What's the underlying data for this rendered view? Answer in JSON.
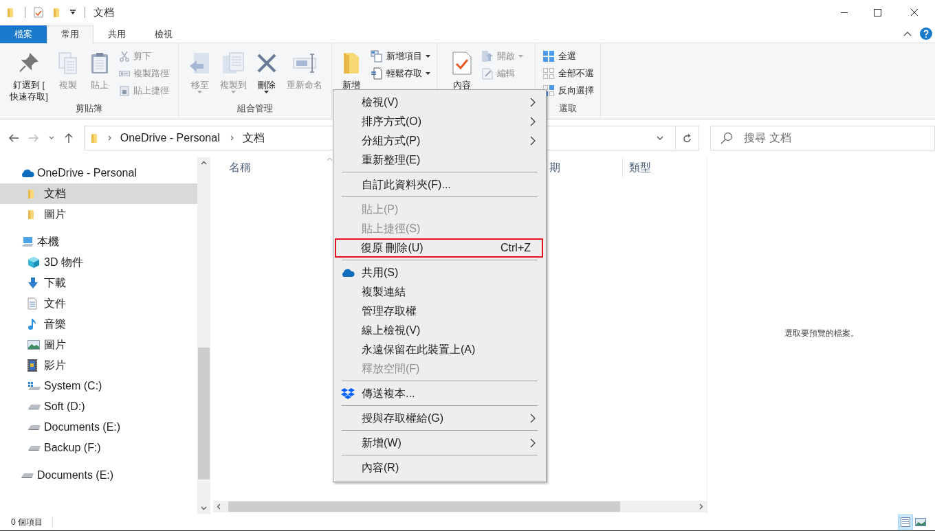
{
  "window": {
    "title": "文档"
  },
  "ribbon_tabs": [
    {
      "label": "檔案",
      "kind": "file",
      "selected": false
    },
    {
      "label": "常用",
      "kind": "tab",
      "selected": true
    },
    {
      "label": "共用",
      "kind": "tab",
      "selected": false
    },
    {
      "label": "檢視",
      "kind": "tab",
      "selected": false
    }
  ],
  "ribbon_groups": [
    {
      "label": "剪貼簿",
      "items": [
        {
          "kind": "large",
          "label": "釘選到 [\n快速存取]",
          "disabled": false,
          "dropdown": false
        },
        {
          "kind": "large",
          "label": "複製",
          "disabled": true,
          "dropdown": false
        },
        {
          "kind": "large",
          "label": "貼上",
          "disabled": true,
          "dropdown": false
        },
        {
          "kind": "stack",
          "items": [
            {
              "label": "剪下",
              "disabled": true,
              "dropdown": false
            },
            {
              "label": "複製路徑",
              "disabled": true,
              "dropdown": false
            },
            {
              "label": "貼上捷徑",
              "disabled": true,
              "dropdown": false
            }
          ]
        }
      ]
    },
    {
      "label": "組合管理",
      "items": [
        {
          "kind": "large",
          "label": "移至",
          "disabled": true,
          "dropdown": true
        },
        {
          "kind": "large",
          "label": "複製到",
          "disabled": true,
          "dropdown": true
        },
        {
          "kind": "large",
          "label": "刪除",
          "disabled": false,
          "dropdown": true
        },
        {
          "kind": "large",
          "label": "重新命名",
          "disabled": true,
          "dropdown": false
        }
      ]
    },
    {
      "items": [
        {
          "kind": "large",
          "label": "新增",
          "disabled": false,
          "dropdown": false
        },
        {
          "kind": "stack",
          "items": [
            {
              "label": "新增項目",
              "disabled": false,
              "dropdown": true
            },
            {
              "label": "輕鬆存取",
              "disabled": false,
              "dropdown": true
            }
          ]
        }
      ]
    },
    {
      "items": [
        {
          "kind": "large",
          "label": "內容",
          "disabled": false,
          "dropdown": false
        },
        {
          "kind": "stack",
          "items": [
            {
              "label": "開啟",
              "disabled": true,
              "dropdown": true
            },
            {
              "label": "編輯",
              "disabled": true,
              "dropdown": false
            }
          ]
        }
      ]
    },
    {
      "label": "選取",
      "items": [
        {
          "kind": "stack",
          "items": [
            {
              "label": "全選",
              "disabled": false,
              "dropdown": false
            },
            {
              "label": "全部不選",
              "disabled": false,
              "dropdown": false
            },
            {
              "label": "反向選擇",
              "disabled": false,
              "dropdown": false
            }
          ]
        }
      ]
    }
  ],
  "address": {
    "crumbs": [
      "OneDrive - Personal",
      "文档"
    ]
  },
  "search": {
    "placeholder": "搜尋 文档"
  },
  "nav_tree": [
    {
      "label": "OneDrive - Personal",
      "kind": "cloud",
      "selected": false,
      "children": [
        {
          "label": "文档",
          "kind": "folder",
          "selected": true
        },
        {
          "label": "圖片",
          "kind": "folder",
          "selected": false
        }
      ]
    },
    {
      "label": "本機",
      "kind": "computer",
      "selected": false,
      "children": [
        {
          "label": "3D 物件",
          "kind": "cube",
          "selected": false
        },
        {
          "label": "下載",
          "kind": "download",
          "selected": false
        },
        {
          "label": "文件",
          "kind": "document",
          "selected": false
        },
        {
          "label": "音樂",
          "kind": "music",
          "selected": false
        },
        {
          "label": "圖片",
          "kind": "picture",
          "selected": false
        },
        {
          "label": "影片",
          "kind": "video",
          "selected": false
        },
        {
          "label": "System (C:)",
          "kind": "system-drive",
          "selected": false
        },
        {
          "label": "Soft (D:)",
          "kind": "drive",
          "selected": false
        },
        {
          "label": "Documents (E:)",
          "kind": "drive",
          "selected": false
        },
        {
          "label": "Backup (F:)",
          "kind": "drive",
          "selected": false
        }
      ]
    },
    {
      "label": "Documents (E:)",
      "kind": "drive",
      "selected": false
    }
  ],
  "table": {
    "columns": [
      "名稱",
      "期",
      "類型"
    ]
  },
  "preview": {
    "text": "選取要預覽的檔案。"
  },
  "context_menu": [
    [
      {
        "label": "檢視(V)",
        "kind": "plain",
        "submenu": true,
        "disabled": false,
        "marked": false
      },
      {
        "label": "排序方式(O)",
        "kind": "plain",
        "submenu": true,
        "disabled": false,
        "marked": false
      },
      {
        "label": "分組方式(P)",
        "kind": "plain",
        "submenu": true,
        "disabled": false,
        "marked": false
      },
      {
        "label": "重新整理(E)",
        "kind": "plain",
        "submenu": false,
        "disabled": false,
        "marked": false
      }
    ],
    [
      {
        "label": "自訂此資料夾(F)...",
        "kind": "plain",
        "submenu": false,
        "disabled": false,
        "marked": false
      }
    ],
    [
      {
        "label": "貼上(P)",
        "kind": "plain",
        "submenu": false,
        "disabled": true,
        "marked": false
      },
      {
        "label": "貼上捷徑(S)",
        "kind": "plain",
        "submenu": false,
        "disabled": true,
        "marked": false
      },
      {
        "label": "復原 刪除(U)",
        "shortcut": "Ctrl+Z",
        "kind": "plain",
        "submenu": false,
        "disabled": false,
        "marked": true
      }
    ],
    [
      {
        "label": "共用(S)",
        "kind": "cloud",
        "submenu": false,
        "disabled": false,
        "marked": false
      },
      {
        "label": "複製連結",
        "kind": "plain",
        "submenu": false,
        "disabled": false,
        "marked": false
      },
      {
        "label": "管理存取權",
        "kind": "plain",
        "submenu": false,
        "disabled": false,
        "marked": false
      },
      {
        "label": "線上檢視(V)",
        "kind": "plain",
        "submenu": false,
        "disabled": false,
        "marked": false
      },
      {
        "label": "永遠保留在此裝置上(A)",
        "kind": "plain",
        "submenu": false,
        "disabled": false,
        "marked": false
      },
      {
        "label": "釋放空間(F)",
        "kind": "plain",
        "submenu": false,
        "disabled": true,
        "marked": false
      }
    ],
    [
      {
        "label": "傳送複本...",
        "kind": "dropbox",
        "submenu": false,
        "disabled": false,
        "marked": false
      }
    ],
    [
      {
        "label": "授與存取權給(G)",
        "kind": "plain",
        "submenu": true,
        "disabled": false,
        "marked": false
      }
    ],
    [
      {
        "label": "新增(W)",
        "kind": "plain",
        "submenu": true,
        "disabled": false,
        "marked": false
      }
    ],
    [
      {
        "label": "內容(R)",
        "kind": "plain",
        "submenu": false,
        "disabled": false,
        "marked": false
      }
    ]
  ],
  "status_bar": {
    "text": "0 個項目",
    "views": [
      {
        "selected": true
      },
      {
        "selected": false
      }
    ]
  }
}
